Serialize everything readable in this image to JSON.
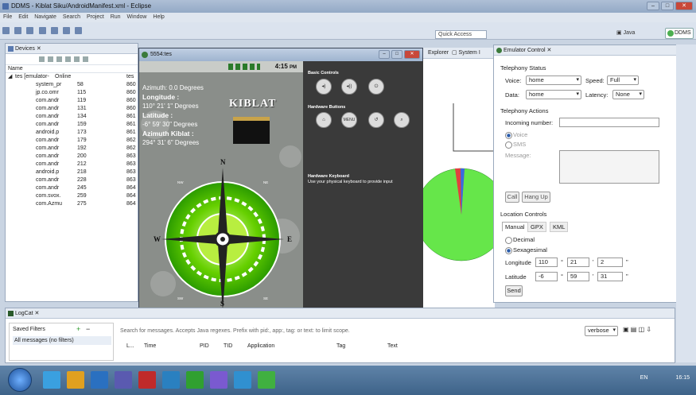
{
  "window": {
    "title": "DDMS - Kiblat Siku/AndroidManifest.xml - Eclipse"
  },
  "menu": [
    "File",
    "Edit",
    "Navigate",
    "Search",
    "Project",
    "Run",
    "Window",
    "Help"
  ],
  "toolbar": {
    "quick_access": "Quick Access",
    "java": "Java",
    "ddms": "DDMS"
  },
  "devices": {
    "tab": "Devices",
    "col_name": "Name",
    "root": {
      "name": "tes [emulator-",
      "status": "Online",
      "extra": "tes"
    },
    "rows": [
      {
        "name": "system_pr",
        "pid": "58",
        "port": "860"
      },
      {
        "name": "jp.co.omr",
        "pid": "115",
        "port": "860"
      },
      {
        "name": "com.andr",
        "pid": "119",
        "port": "860"
      },
      {
        "name": "com.andr",
        "pid": "131",
        "port": "860"
      },
      {
        "name": "com.andr",
        "pid": "134",
        "port": "861"
      },
      {
        "name": "com.andr",
        "pid": "159",
        "port": "861"
      },
      {
        "name": "android.p",
        "pid": "173",
        "port": "861"
      },
      {
        "name": "com.andr",
        "pid": "179",
        "port": "862"
      },
      {
        "name": "com.andr",
        "pid": "192",
        "port": "862"
      },
      {
        "name": "com.andr",
        "pid": "200",
        "port": "863"
      },
      {
        "name": "com.andr",
        "pid": "212",
        "port": "863"
      },
      {
        "name": "android.p",
        "pid": "218",
        "port": "863"
      },
      {
        "name": "com.andr",
        "pid": "228",
        "port": "863"
      },
      {
        "name": "com.andr",
        "pid": "245",
        "port": "864"
      },
      {
        "name": "com.svox.",
        "pid": "259",
        "port": "864"
      },
      {
        "name": "com.Azmu",
        "pid": "275",
        "port": "864"
      }
    ]
  },
  "emulator": {
    "title": "5554:tes",
    "time": "4:15",
    "ampm": "PM",
    "azimuth": "Azimuth: 0.0 Degrees",
    "longitude_label": "Longitude :",
    "longitude_value": "110° 21' 1\" Degrees",
    "latitude_label": "Latitude :",
    "latitude_value": "-6° 59' 30\" Degrees",
    "azimuth_kiblat_label": "Azimuth Kiblat :",
    "azimuth_kiblat_value": "294° 31' 6\" Degrees",
    "logo": "KIBLAT",
    "compass": {
      "n": "N",
      "s": "S",
      "e": "E",
      "w": "W",
      "nw": "NW",
      "ne": "NE",
      "sw": "SW",
      "se": "SE"
    },
    "basic_controls": "Basic Controls",
    "hardware_buttons": "Hardware Buttons",
    "menu_btn": "MENU",
    "hardware_keyboard": "Hardware Keyboard",
    "keyboard_hint": "Use your physical keyboard to provide input"
  },
  "side_tabs": {
    "explorer": "Explorer",
    "system": "System I"
  },
  "emulator_control": {
    "tab": "Emulator Control",
    "telephony_status": "Telephony Status",
    "voice_label": "Voice:",
    "voice": "home",
    "speed_label": "Speed:",
    "speed": "Full",
    "data_label": "Data:",
    "data": "home",
    "latency_label": "Latency:",
    "latency": "None",
    "telephony_actions": "Telephony Actions",
    "incoming_label": "Incoming number:",
    "voice_radio": "Voice",
    "sms_radio": "SMS",
    "message_label": "Message:",
    "call": "Call",
    "hangup": "Hang Up",
    "location_controls": "Location Controls",
    "tabs": [
      "Manual",
      "GPX",
      "KML"
    ],
    "decimal": "Decimal",
    "sexagesimal": "Sexagesimal",
    "longitude": "Longitude",
    "lon_d": "110",
    "lon_m": "21",
    "lon_s": "2",
    "latitude": "Latitude",
    "lat_d": "-6",
    "lat_m": "59",
    "lat_s": "31",
    "send": "Send"
  },
  "logcat": {
    "tab": "LogCat",
    "saved_filters": "Saved Filters",
    "all_messages": "All messages (no filters)",
    "search_placeholder": "Search for messages. Accepts Java regexes. Prefix with pid:, app:, tag: or text: to limit scope.",
    "level": "verbose",
    "cols": [
      "L...",
      "Time",
      "PID",
      "TID",
      "Application",
      "Tag",
      "Text"
    ]
  },
  "taskbar": {
    "lang": "EN",
    "clock": "16:15"
  }
}
